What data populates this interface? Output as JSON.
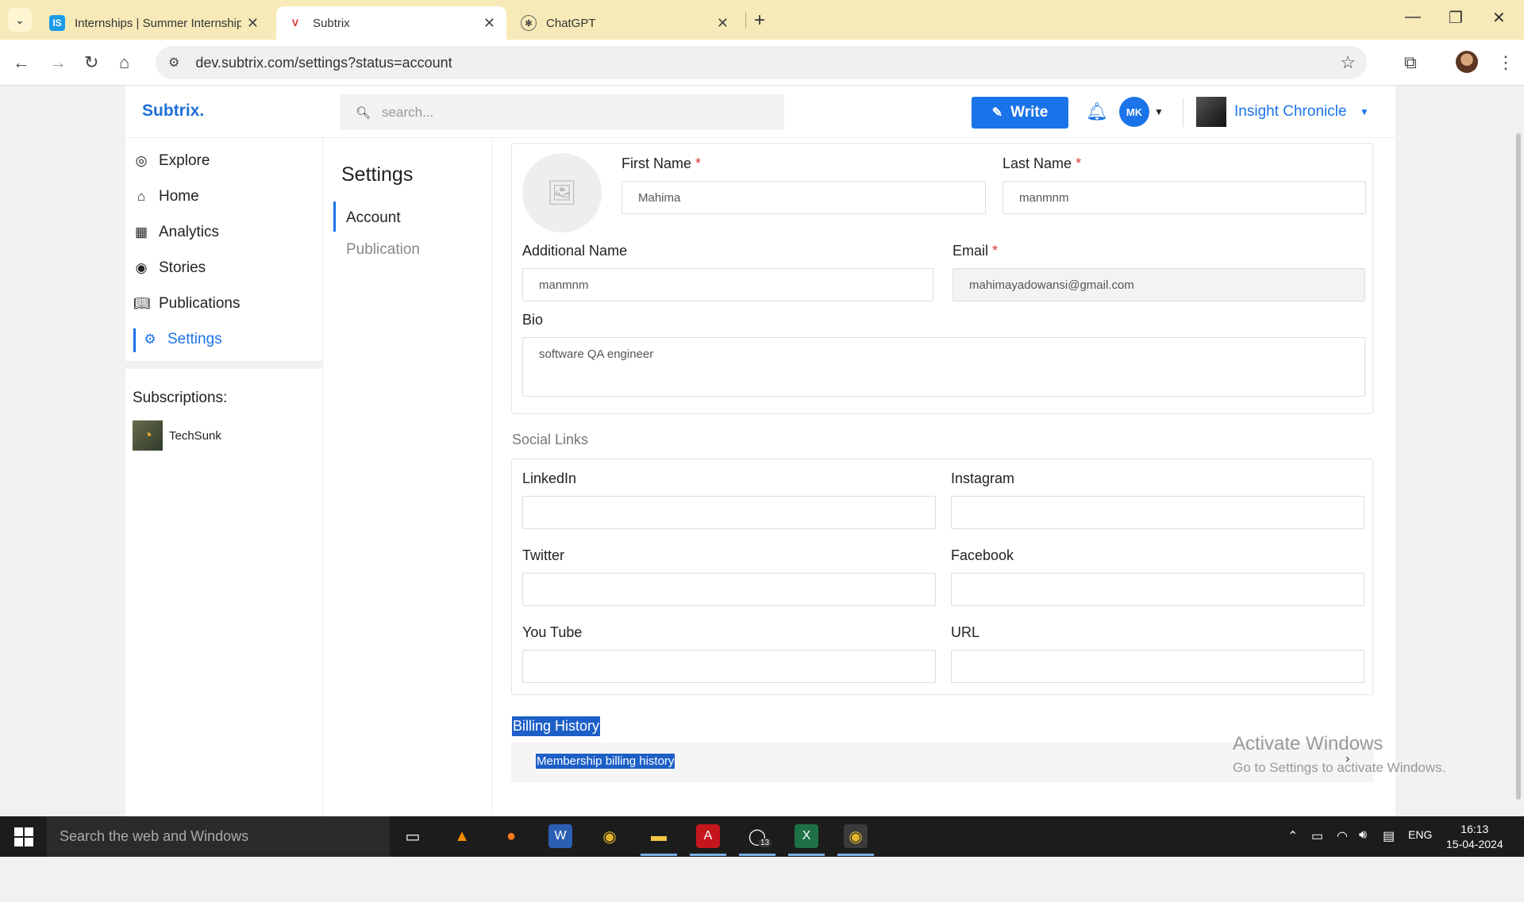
{
  "browser": {
    "tabs": [
      {
        "title": "Internships | Summer Internship",
        "favicon": "IS"
      },
      {
        "title": "Subtrix",
        "favicon": "V"
      },
      {
        "title": "ChatGPT",
        "favicon": ""
      }
    ],
    "url": "dev.subtrix.com/settings?status=account"
  },
  "app": {
    "logo": "Subtrix.",
    "search_placeholder": "search...",
    "write_label": "Write",
    "user_initials": "MK",
    "publication_name": "Insight Chronicle"
  },
  "sidebar": {
    "items": [
      {
        "label": "Explore",
        "icon": "explore-icon"
      },
      {
        "label": "Home",
        "icon": "home-icon"
      },
      {
        "label": "Analytics",
        "icon": "analytics-icon"
      },
      {
        "label": "Stories",
        "icon": "stories-icon"
      },
      {
        "label": "Publications",
        "icon": "publications-icon"
      },
      {
        "label": "Settings",
        "icon": "settings-icon",
        "active": true
      }
    ],
    "subscriptions_title": "Subscriptions:",
    "subscriptions": [
      {
        "name": "TechSunk"
      }
    ]
  },
  "settings": {
    "title": "Settings",
    "menu": [
      "Account",
      "Publication"
    ],
    "active": "Account"
  },
  "form": {
    "first_name_label": "First Name",
    "first_name_value": "Mahima",
    "last_name_label": "Last Name",
    "last_name_value": "manmnm",
    "additional_name_label": "Additional Name",
    "additional_name_value": "manmnm",
    "email_label": "Email",
    "email_value": "mahimayadowansi@gmail.com",
    "bio_label": "Bio",
    "bio_value": "software QA engineer",
    "required_mark": "*"
  },
  "social": {
    "title": "Social Links",
    "linkedin": "LinkedIn",
    "instagram": "Instagram",
    "twitter": "Twitter",
    "facebook": "Facebook",
    "youtube": "You Tube",
    "url": "URL"
  },
  "billing": {
    "title": "Billing History",
    "link": "Membership billing history"
  },
  "watermark": {
    "line1": "Activate Windows",
    "line2": "Go to Settings to activate Windows."
  },
  "taskbar": {
    "search_placeholder": "Search the web and Windows",
    "lang": "ENG",
    "time": "16:13",
    "date": "15-04-2024",
    "whatsapp_badge": "13"
  },
  "colors": {
    "accent": "#1a73e8",
    "tabbar": "#f7eab8",
    "required": "#e53935"
  }
}
